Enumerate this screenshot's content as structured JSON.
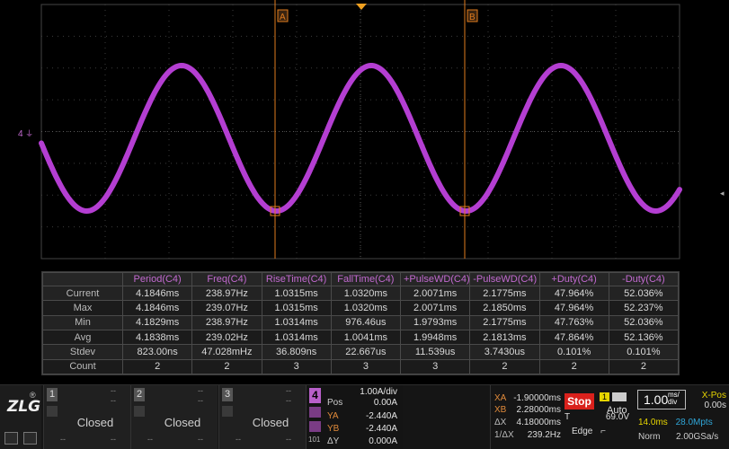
{
  "scope": {
    "channel_marker": "4",
    "cursor_a_label": "A",
    "cursor_b_label": "B"
  },
  "measurements": {
    "headers": [
      "Period(C4)",
      "Freq(C4)",
      "RiseTime(C4)",
      "FallTime(C4)",
      "+PulseWD(C4)",
      "-PulseWD(C4)",
      "+Duty(C4)",
      "-Duty(C4)"
    ],
    "rows": [
      {
        "label": "Current",
        "values": [
          "4.1846ms",
          "238.97Hz",
          "1.0315ms",
          "1.0320ms",
          "2.0071ms",
          "2.1775ms",
          "47.964%",
          "52.036%"
        ]
      },
      {
        "label": "Max",
        "values": [
          "4.1846ms",
          "239.07Hz",
          "1.0315ms",
          "1.0320ms",
          "2.0071ms",
          "2.1850ms",
          "47.964%",
          "52.237%"
        ]
      },
      {
        "label": "Min",
        "values": [
          "4.1829ms",
          "238.97Hz",
          "1.0314ms",
          "976.46us",
          "1.9793ms",
          "2.1775ms",
          "47.763%",
          "52.036%"
        ]
      },
      {
        "label": "Avg",
        "values": [
          "4.1838ms",
          "239.02Hz",
          "1.0314ms",
          "1.0041ms",
          "1.9948ms",
          "2.1813ms",
          "47.864%",
          "52.136%"
        ]
      },
      {
        "label": "Stdev",
        "values": [
          "823.00ns",
          "47.028mHz",
          "36.809ns",
          "22.667us",
          "11.539us",
          "3.7430us",
          "0.101%",
          "0.101%"
        ]
      },
      {
        "label": "Count",
        "values": [
          "2",
          "2",
          "3",
          "3",
          "3",
          "2",
          "2",
          "2"
        ]
      }
    ]
  },
  "bottom": {
    "logo": "ZLG",
    "registered": "®",
    "channels": [
      {
        "num": "1",
        "state": "Closed",
        "dash": "--"
      },
      {
        "num": "2",
        "state": "Closed",
        "dash": "--"
      },
      {
        "num": "3",
        "state": "Closed",
        "dash": "--"
      }
    ],
    "c4": {
      "num": "4",
      "scale": "1.00A/div",
      "pos_label": "Pos",
      "pos_value": "0.00A",
      "ya_label": "YA",
      "ya_value": "-2.440A",
      "yb_label": "YB",
      "yb_value": "-2.440A",
      "dy_label": "ΔY",
      "dy_value": "0.000A",
      "bits_label": "101"
    },
    "cursors": {
      "xa_label": "XA",
      "xa_value": "-1.90000ms",
      "xb_label": "XB",
      "xb_value": "2.28000ms",
      "dx_label": "ΔX",
      "dx_value": "4.18000ms",
      "inv_label": "1/ΔX",
      "inv_value": "239.2Hz"
    },
    "trigger": {
      "stop_label": "Stop",
      "channel": "1",
      "mode": "Auto",
      "t_label": "T",
      "level": "69.0V",
      "type": "Edge"
    },
    "timebase": {
      "value": "1.00",
      "unit_top": "ms/",
      "unit_bottom": "div",
      "xpos_label": "X-Pos",
      "xpos_value": "0.00s",
      "memory": "14.0ms",
      "points": "28.0Mpts",
      "acq_mode": "Norm",
      "sample_rate": "2.00GSa/s"
    }
  },
  "colors": {
    "trace": "#b43ed2",
    "cursor": "#e07b1e",
    "grid": "#3c3c3c",
    "header_text": "#c26ad0",
    "stop": "#d9211c"
  }
}
